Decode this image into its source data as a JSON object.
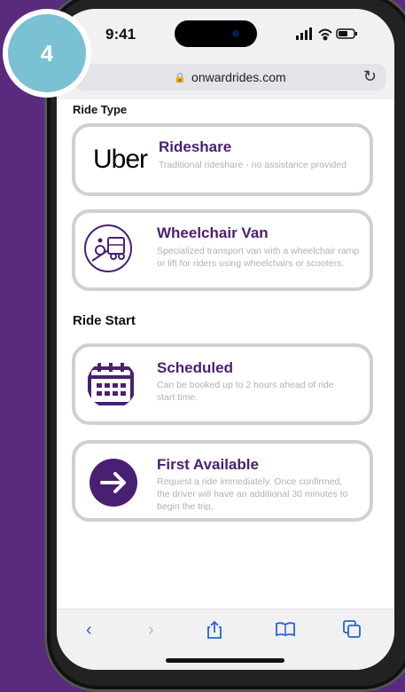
{
  "status_bar": {
    "time": "9:41"
  },
  "browser": {
    "url": "onwardrides.com"
  },
  "badge": {
    "number": "4"
  },
  "sections": {
    "ride_type": "Ride Type",
    "ride_start": "Ride Start"
  },
  "ride_type_options": [
    {
      "logo_text": "Uber",
      "title": "Rideshare",
      "description": "Traditional rideshare - no assistance provided"
    },
    {
      "title": "Wheelchair Van",
      "description": "Specialized transport van with a wheelchair ramp or lift for riders using wheelchairs or scooters."
    }
  ],
  "ride_start_options": [
    {
      "title": "Scheduled",
      "description": "Can be booked up to 2 hours ahead of ride start time."
    },
    {
      "title": "First Available",
      "description": "Request a ride immediately. Once confirmed, the driver will have an additional 30 minutes to begin the trip."
    }
  ],
  "colors": {
    "background": "#5a2a7f",
    "accent": "#4a1f73",
    "badge": "#7ac1d4",
    "link": "#2a63d8"
  }
}
